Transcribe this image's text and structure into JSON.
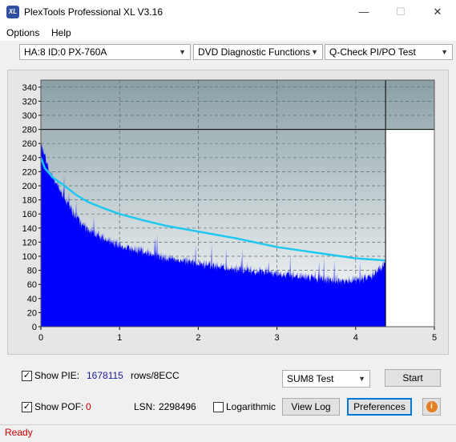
{
  "window": {
    "title": "PlexTools Professional XL V3.16",
    "logo": "XL",
    "minimize": "—",
    "maximize": "☐",
    "close": "✕"
  },
  "menu": {
    "items": [
      "Options",
      "Help"
    ]
  },
  "toolbar": {
    "drive": "HA:8 ID:0  PX-760A",
    "function": "DVD Diagnostic Functions",
    "test": "Q-Check PI/PO Test"
  },
  "chart_data": {
    "type": "area",
    "x_ticks": [
      "0",
      "1",
      "2",
      "3",
      "4",
      "5"
    ],
    "y_ticks": [
      "0",
      "20",
      "40",
      "60",
      "80",
      "100",
      "120",
      "140",
      "160",
      "180",
      "200",
      "220",
      "240",
      "260",
      "280",
      "300",
      "320",
      "340"
    ],
    "xlim": [
      0,
      5
    ],
    "ylim": [
      0,
      350
    ],
    "threshold_line_y": 280,
    "end_marker_x": 4.38,
    "grid": true,
    "series": [
      {
        "type": "area",
        "color": "#0000ff",
        "x": [
          0.0,
          0.05,
          0.1,
          0.2,
          0.3,
          0.4,
          0.5,
          0.6,
          0.8,
          1.0,
          1.2,
          1.5,
          1.8,
          2.0,
          2.3,
          2.6,
          3.0,
          3.3,
          3.6,
          3.9,
          4.1,
          4.2,
          4.3,
          4.38
        ],
        "values": [
          260,
          245,
          225,
          205,
          185,
          165,
          150,
          140,
          128,
          118,
          112,
          102,
          96,
          92,
          87,
          83,
          78,
          74,
          70,
          68,
          70,
          75,
          85,
          92
        ]
      },
      {
        "type": "line",
        "color": "#1ec8f0",
        "x": [
          0.0,
          0.05,
          0.15,
          0.3,
          0.45,
          0.6,
          0.8,
          1.0,
          1.3,
          1.6,
          2.0,
          2.5,
          3.0,
          3.5,
          4.0,
          4.38
        ],
        "values": [
          240,
          225,
          212,
          200,
          187,
          177,
          168,
          160,
          151,
          143,
          135,
          125,
          113,
          105,
          97,
          94
        ]
      }
    ]
  },
  "stats": {
    "show_pie_label": "Show PIE:",
    "pie_value": "1678115",
    "pie_unit": "rows/8ECC",
    "show_pof_label": "Show POF:",
    "pof_value": "0",
    "lsn_label": "LSN:",
    "lsn_value": "2298496",
    "logarithmic_label": "Logarithmic",
    "show_pie_checked": "✓",
    "show_pof_checked": "✓"
  },
  "controls": {
    "mode": "SUM8 Test",
    "start": "Start",
    "view_log": "View Log",
    "preferences": "Preferences",
    "info": "i"
  },
  "status": {
    "text": "Ready"
  },
  "colors": {
    "pie_value": "#1a1aa0",
    "pof_value": "#cc0000",
    "status": "#cc0000"
  }
}
